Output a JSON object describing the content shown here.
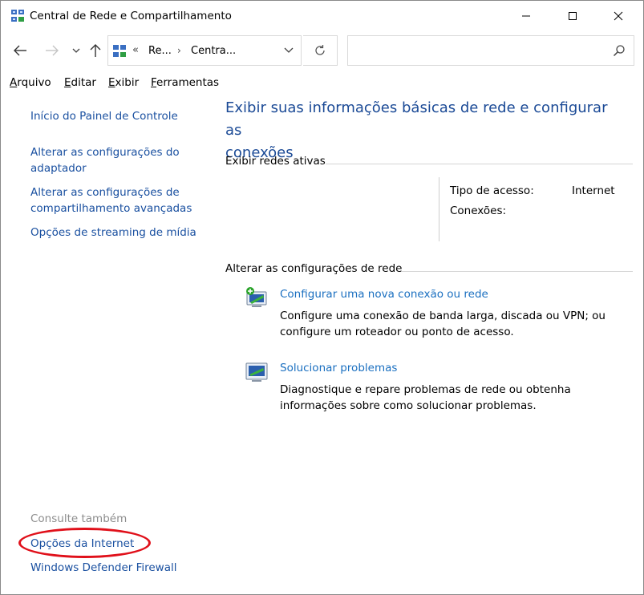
{
  "window": {
    "title": "Central de Rede e Compartilhamento"
  },
  "icons": {
    "title": "network-center-icon",
    "back": "arrow-left-icon",
    "forward": "arrow-right-icon",
    "recent": "chevron-down-icon",
    "up": "arrow-up-icon",
    "refresh": "refresh-icon",
    "search": "search-icon",
    "minimize": "minimize-icon",
    "maximize": "maximize-icon",
    "close": "close-icon"
  },
  "address": {
    "overflow": "«",
    "crumb1": "Re...",
    "separator": "›",
    "crumb2": "Centra..."
  },
  "search": {
    "value": "",
    "placeholder": ""
  },
  "menu": {
    "file": "Arquivo",
    "edit": "Editar",
    "view": "Exibir",
    "tools": "Ferramentas"
  },
  "sidebar": {
    "home": "Início do Painel de Controle",
    "adapter_line1": "Alterar as configurações do",
    "adapter_line2": "adaptador",
    "sharing_line1": "Alterar as configurações de",
    "sharing_line2": "compartilhamento avançadas",
    "streaming": "Opções de streaming de mídia",
    "see_also": "Consulte também",
    "internet_options": "Opções da Internet",
    "firewall": "Windows Defender Firewall"
  },
  "main": {
    "title_line1": "Exibir suas informações básicas de rede e configurar as",
    "title_line2": "conexões",
    "active_networks": "Exibir redes ativas",
    "access_type_label": "Tipo de acesso:",
    "access_type_value": "Internet",
    "connections_label": "Conexões:",
    "change_settings": "Alterar as configurações de rede",
    "task1_link": "Configurar uma nova conexão ou rede",
    "task1_desc_line1": "Configure uma conexão de banda larga, discada ou VPN; ou",
    "task1_desc_line2": "configure um roteador ou ponto de acesso.",
    "task2_link": "Solucionar problemas",
    "task2_desc_line1": "Diagnostique e repare problemas de rede ou obtenha",
    "task2_desc_line2": "informações sobre como solucionar problemas."
  },
  "colors": {
    "link": "#1a50a0",
    "title_blue": "#1b4a96",
    "highlight": "#e0101a"
  }
}
